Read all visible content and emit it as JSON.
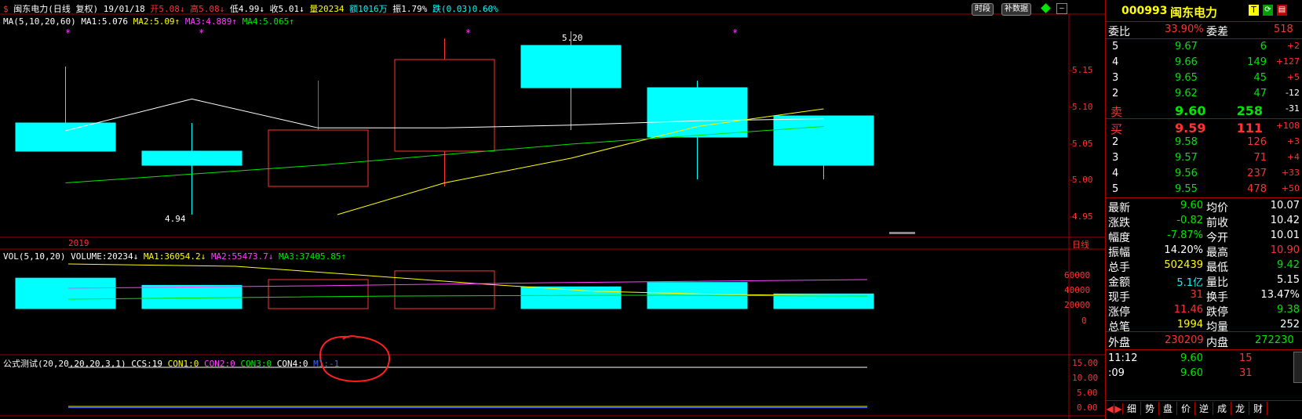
{
  "header": {
    "dollar": "$",
    "name": "闽东电力(日线 复权)",
    "date": "19/01/18",
    "open": "开5.08↓",
    "high": "高5.08↓",
    "low": "低4.99↓",
    "close": "收5.01↓",
    "volume": "量20234",
    "amount": "额1016万",
    "amplitude": "振1.79%",
    "change": "跌(0.03)0.60%",
    "btn_time": "时段",
    "btn_data": "补数据"
  },
  "ma_line": {
    "label": "MA(5,10,20,60)",
    "ma1": "MA1:5.076",
    "ma2": "MA2:5.09↑",
    "ma3": "MA3:4.889↑",
    "ma4": "MA4:5.065↑"
  },
  "price_axis": {
    "ticks": [
      "5.15",
      "5.10",
      "5.05",
      "5.00",
      "4.95"
    ]
  },
  "year_label": "2019",
  "period_label": "日线",
  "annotations": {
    "high": "5.20",
    "low": "4.94"
  },
  "vol_line": {
    "label": "VOL(5,10,20)",
    "volume": "VOLUME:20234↓",
    "ma1": "MA1:36054.2↓",
    "ma2": "MA2:55473.7↓",
    "ma3": "MA3:37405.85↑"
  },
  "vol_axis": {
    "ticks": [
      "60000",
      "40000",
      "20000",
      "0"
    ]
  },
  "formula_line": {
    "label": "公式测试(20,20,20,20,3,1)",
    "ccs": "CCS:19",
    "con1": "CON1:0",
    "con2": "CON2:0",
    "con3": "CON3:0",
    "con4": "CON4:0",
    "m1": "M1:-1"
  },
  "formula_axis": {
    "ticks": [
      "15.00",
      "10.00",
      "5.00",
      "0.00"
    ]
  },
  "chart_data": {
    "type": "candlestick",
    "y_range": [
      4.93,
      5.2
    ],
    "candles": [
      {
        "open": 5.07,
        "close": 5.03,
        "high": 5.15,
        "low": 5.03,
        "up": false
      },
      {
        "open": 5.03,
        "close": 5.01,
        "high": 5.07,
        "low": 4.94,
        "up": false
      },
      {
        "open": 4.98,
        "close": 5.06,
        "high": 5.13,
        "low": 4.98,
        "up": true
      },
      {
        "open": 5.03,
        "close": 5.16,
        "high": 5.19,
        "low": 4.98,
        "up": true
      },
      {
        "open": 5.18,
        "close": 5.12,
        "high": 5.2,
        "low": 5.06,
        "up": false
      },
      {
        "open": 5.12,
        "close": 5.05,
        "high": 5.13,
        "low": 4.99,
        "up": false
      },
      {
        "open": 5.08,
        "close": 5.01,
        "high": 5.08,
        "low": 4.99,
        "up": false
      }
    ],
    "volume": [
      42000,
      32000,
      40000,
      52000,
      30000,
      36000,
      20234
    ],
    "vol_range": [
      0,
      80000
    ]
  },
  "quote": {
    "code": "000993",
    "name": "闽东电力",
    "t_btn": "T",
    "ratio_label": "委比",
    "ratio_value": "33.90%",
    "diff_label": "委差",
    "diff_value": "518",
    "sell": [
      {
        "lvl": "5",
        "price": "9.67",
        "vol": "6",
        "chg": "+2"
      },
      {
        "lvl": "4",
        "price": "9.66",
        "vol": "149",
        "chg": "+127"
      },
      {
        "lvl": "3",
        "price": "9.65",
        "vol": "45",
        "chg": "+5"
      },
      {
        "lvl": "2",
        "price": "9.62",
        "vol": "47",
        "chg": "-12"
      },
      {
        "lvl": "卖",
        "price": "9.60",
        "vol": "258",
        "chg": "-31"
      }
    ],
    "buy": [
      {
        "lvl": "买",
        "price": "9.59",
        "vol": "111",
        "chg": "+108"
      },
      {
        "lvl": "2",
        "price": "9.58",
        "vol": "126",
        "chg": "+3"
      },
      {
        "lvl": "3",
        "price": "9.57",
        "vol": "71",
        "chg": "+4"
      },
      {
        "lvl": "4",
        "price": "9.56",
        "vol": "237",
        "chg": "+33"
      },
      {
        "lvl": "5",
        "price": "9.55",
        "vol": "478",
        "chg": "+50"
      }
    ],
    "stats": [
      {
        "l1": "最新",
        "v1": "9.60",
        "l2": "均价",
        "v2": "10.07"
      },
      {
        "l1": "涨跌",
        "v1": "-0.82",
        "l2": "前收",
        "v2": "10.42"
      },
      {
        "l1": "幅度",
        "v1": "-7.87%",
        "l2": "今开",
        "v2": "10.01"
      },
      {
        "l1": "振幅",
        "v1": "14.20%",
        "l2": "最高",
        "v2": "10.90"
      },
      {
        "l1": "总手",
        "v1": "502439",
        "l2": "最低",
        "v2": "9.42"
      },
      {
        "l1": "金额",
        "v1": "5.1亿",
        "l2": "量比",
        "v2": "5.15"
      },
      {
        "l1": "现手",
        "v1": "31",
        "l2": "换手",
        "v2": "13.47%"
      },
      {
        "l1": "涨停",
        "v1": "11.46",
        "l2": "跌停",
        "v2": "9.38"
      },
      {
        "l1": "总笔",
        "v1": "1994",
        "l2": "均量",
        "v2": "252"
      }
    ],
    "outer_label": "外盘",
    "outer_value": "230209",
    "inner_label": "内盘",
    "inner_value": "272230",
    "ticks": [
      {
        "time": "11:12",
        "price": "9.60",
        "vol": "15"
      },
      {
        "time": ":09",
        "price": "9.60",
        "vol": "31"
      }
    ],
    "tabs": [
      "细",
      "势",
      "盘",
      "价",
      "逆",
      "成",
      "龙",
      "财"
    ]
  }
}
